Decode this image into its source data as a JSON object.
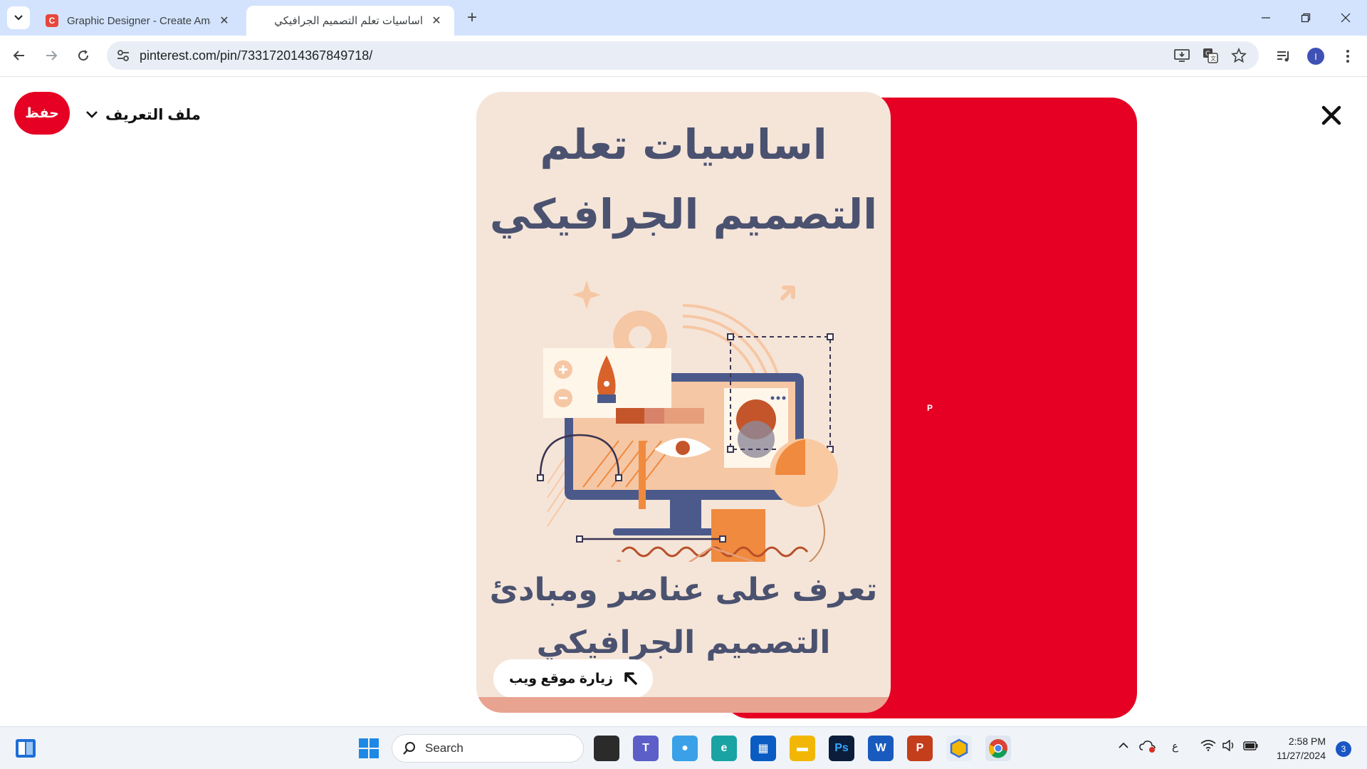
{
  "browser": {
    "tabs": [
      {
        "title": "Graphic Designer - Create Ama",
        "favicon": "canva-icon",
        "active": false
      },
      {
        "title": "اساسيات تعلم التصميم الجرافيكي",
        "favicon": "pinterest-icon",
        "active": true
      }
    ],
    "url": "pinterest.com/pin/733172014367849718/",
    "profile_initial": "I"
  },
  "page": {
    "save_label": "حفظ",
    "profile_label": "ملف التعريف",
    "pin": {
      "title_line1": "اساسيات تعلم",
      "title_line2": "التصميم الجرافيكي",
      "subtitle_line1": "تعرف على عناصر ومبادئ",
      "subtitle_line2": "التصميم الجرافيكي",
      "visit_label": "زيارة موقع ويب"
    }
  },
  "taskbar": {
    "search_placeholder": "Search",
    "keyboard_lang": "ع",
    "time": "2:58 PM",
    "date": "11/27/2024",
    "notification_count": "3"
  },
  "colors": {
    "tabstrip": "#d3e3fd",
    "pinterest_red": "#e60023",
    "pin_bg": "#f5e5d8",
    "pin_text": "#4b5270"
  }
}
